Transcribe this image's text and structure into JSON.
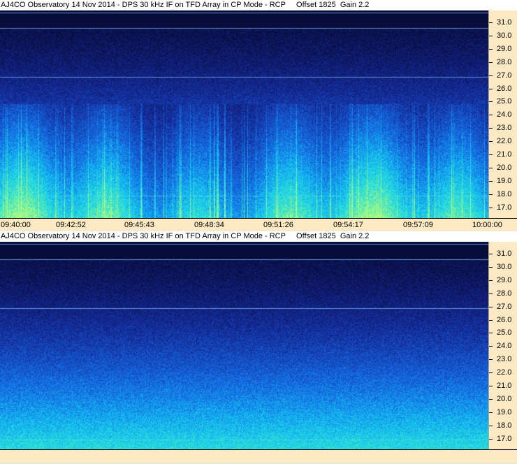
{
  "panels": [
    {
      "title": "AJ4CO Observatory 14 Nov 2014 - DPS 30 kHz IF on TFD Array in CP Mode - RCP     Offset 1825  Gain 2.2",
      "freq_labels": [
        "31.0",
        "30.0",
        "29.0",
        "28.0",
        "27.0",
        "26.0",
        "25.0",
        "24.0",
        "23.0",
        "22.0",
        "21.0",
        "20.0",
        "19.0",
        "18.0",
        "17.0"
      ],
      "time_labels": [
        "09:40:00",
        "09:42:52",
        "09:45:43",
        "09:48:34",
        "09:51:26",
        "09:54:17",
        "09:57:09",
        "10:00:00"
      ]
    },
    {
      "title": "AJ4CO Observatory 14 Nov 2014 - DPS 30 kHz IF on TFD Array in CP Mode - RCP     Offset 1825  Gain 2.2",
      "freq_labels": [
        "31.0",
        "30.0",
        "29.0",
        "28.0",
        "27.0",
        "26.0",
        "25.0",
        "24.0",
        "23.0",
        "22.0",
        "21.0",
        "20.0",
        "19.0",
        "18.0",
        "17.0"
      ],
      "time_labels": []
    }
  ],
  "colors": {
    "axis_bg": "#fde9c3",
    "spectrogram_low": "#0b1550",
    "spectrogram_high": "#7cf0a0"
  }
}
